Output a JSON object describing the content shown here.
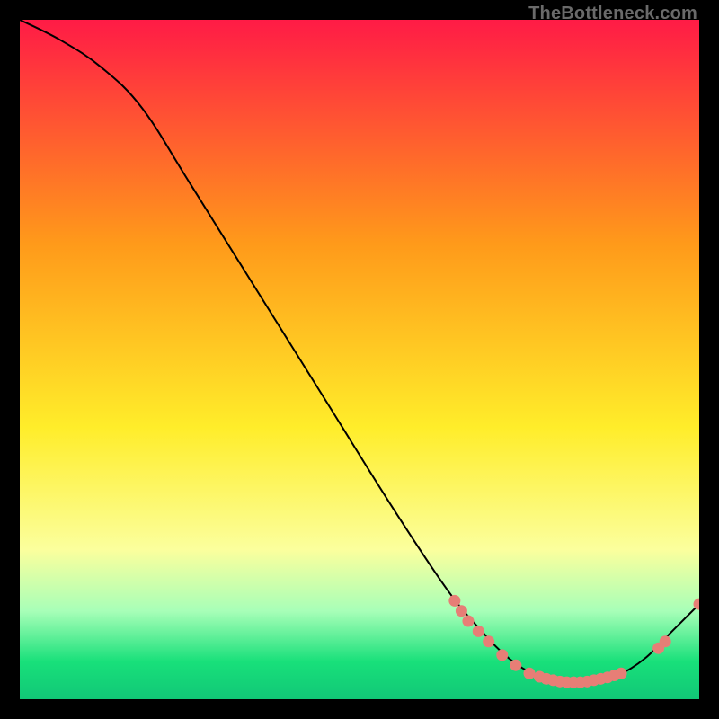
{
  "watermark": "TheBottleneck.com",
  "colors": {
    "red_top": "#ff1b46",
    "orange": "#ff9a1a",
    "yellow": "#ffed2a",
    "pale_yellow": "#fbff9d",
    "mint": "#a8ffb8",
    "green": "#18e07a",
    "teal": "#11c777",
    "marker": "#e77e76",
    "line": "#000000"
  },
  "chart_data": {
    "type": "line",
    "title": "",
    "xlabel": "",
    "ylabel": "",
    "xlim": [
      0,
      100
    ],
    "ylim": [
      0,
      100
    ],
    "curve": [
      {
        "x": 0,
        "y": 100
      },
      {
        "x": 6,
        "y": 97
      },
      {
        "x": 12,
        "y": 93
      },
      {
        "x": 18,
        "y": 87
      },
      {
        "x": 25,
        "y": 76
      },
      {
        "x": 35,
        "y": 60
      },
      {
        "x": 45,
        "y": 44
      },
      {
        "x": 55,
        "y": 28
      },
      {
        "x": 63,
        "y": 16
      },
      {
        "x": 68,
        "y": 10
      },
      {
        "x": 72,
        "y": 6
      },
      {
        "x": 76,
        "y": 3.5
      },
      {
        "x": 80,
        "y": 2.5
      },
      {
        "x": 84,
        "y": 2.5
      },
      {
        "x": 88,
        "y": 3.5
      },
      {
        "x": 92,
        "y": 6
      },
      {
        "x": 96,
        "y": 10
      },
      {
        "x": 100,
        "y": 14
      }
    ],
    "markers": [
      {
        "x": 64,
        "y": 14.5
      },
      {
        "x": 65,
        "y": 13.0
      },
      {
        "x": 66,
        "y": 11.5
      },
      {
        "x": 67.5,
        "y": 10.0
      },
      {
        "x": 69,
        "y": 8.5
      },
      {
        "x": 71,
        "y": 6.5
      },
      {
        "x": 73,
        "y": 5.0
      },
      {
        "x": 75,
        "y": 3.8
      },
      {
        "x": 76.5,
        "y": 3.3
      },
      {
        "x": 77.5,
        "y": 3.0
      },
      {
        "x": 78.5,
        "y": 2.8
      },
      {
        "x": 79.5,
        "y": 2.6
      },
      {
        "x": 80.5,
        "y": 2.5
      },
      {
        "x": 81.5,
        "y": 2.5
      },
      {
        "x": 82.5,
        "y": 2.5
      },
      {
        "x": 83.5,
        "y": 2.6
      },
      {
        "x": 84.5,
        "y": 2.8
      },
      {
        "x": 85.5,
        "y": 3.0
      },
      {
        "x": 86.5,
        "y": 3.2
      },
      {
        "x": 87.5,
        "y": 3.5
      },
      {
        "x": 88.5,
        "y": 3.8
      },
      {
        "x": 94,
        "y": 7.5
      },
      {
        "x": 95,
        "y": 8.5
      },
      {
        "x": 100,
        "y": 14
      }
    ],
    "gradient_stops": [
      {
        "offset": 0.0,
        "color_key": "red_top"
      },
      {
        "offset": 0.33,
        "color_key": "orange"
      },
      {
        "offset": 0.6,
        "color_key": "yellow"
      },
      {
        "offset": 0.78,
        "color_key": "pale_yellow"
      },
      {
        "offset": 0.87,
        "color_key": "mint"
      },
      {
        "offset": 0.945,
        "color_key": "green"
      },
      {
        "offset": 1.0,
        "color_key": "teal"
      }
    ]
  }
}
